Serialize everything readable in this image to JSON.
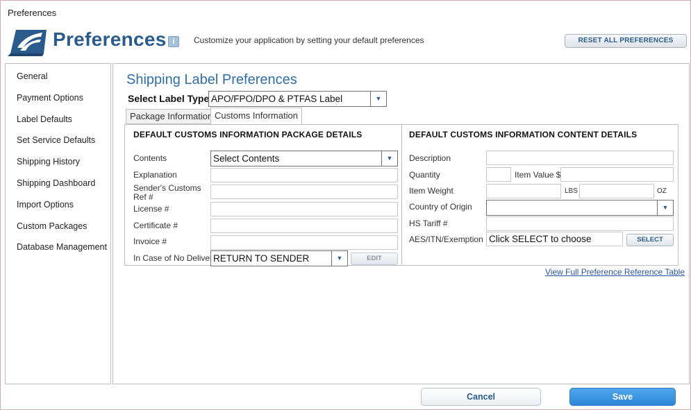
{
  "window": {
    "title": "Preferences"
  },
  "header": {
    "logo_icon": "usps-eagle-logo",
    "title": "Preferences",
    "info_icon": "info-icon",
    "info_glyph": "i",
    "subtitle": "Customize your application by setting your default preferences",
    "reset_label": "RESET ALL PREFERENCES",
    "brand_color": "#2b5b8c"
  },
  "sidebar": {
    "items": [
      {
        "label": "General"
      },
      {
        "label": "Payment Options"
      },
      {
        "label": "Label Defaults"
      },
      {
        "label": "Set Service Defaults"
      },
      {
        "label": "Shipping History"
      },
      {
        "label": "Shipping Dashboard"
      },
      {
        "label": "Import Options"
      },
      {
        "label": "Custom Packages"
      },
      {
        "label": "Database Management"
      }
    ]
  },
  "main": {
    "title": "Shipping Label Preferences",
    "label_type": {
      "label": "Select Label Type:",
      "value": "APO/FPO/DPO & PTFAS Label"
    },
    "tabs": [
      {
        "label": "Package Information",
        "active": false
      },
      {
        "label": "Customs Information",
        "active": true
      }
    ],
    "package_details": {
      "title": "DEFAULT CUSTOMS INFORMATION PACKAGE DETAILS",
      "contents_label": "Contents",
      "contents_value": "Select Contents",
      "explanation_label": "Explanation",
      "explanation_value": "",
      "senders_ref_label_line1": "Sender's Customs",
      "senders_ref_label_line2": "Ref #",
      "senders_ref_value": "",
      "license_label": "License #",
      "license_value": "",
      "certificate_label": "Certificate #",
      "certificate_value": "",
      "invoice_label": "Invoice #",
      "invoice_value": "",
      "no_delivery_label": "In Case of No Delivery",
      "no_delivery_value": "RETURN TO SENDER",
      "edit_label": "EDIT"
    },
    "content_details": {
      "title": "DEFAULT CUSTOMS INFORMATION CONTENT DETAILS",
      "description_label": "Description",
      "description_value": "",
      "quantity_label": "Quantity",
      "quantity_value": "",
      "item_value_label": "Item Value $",
      "item_value_value": "",
      "item_weight_label": "Item Weight",
      "weight_lbs_value": "",
      "lbs_label": "LBS",
      "weight_oz_value": "",
      "oz_label": "OZ",
      "country_label": "Country of Origin",
      "country_value": "",
      "hs_tariff_label": "HS Tariff #",
      "hs_tariff_value": "",
      "aes_label": "AES/ITN/Exemption",
      "aes_value": "Click SELECT to choose",
      "select_label": "SELECT"
    },
    "reference_link": "View Full Preference Reference Table"
  },
  "footer": {
    "cancel_label": "Cancel",
    "save_label": "Save",
    "save_color": "#2e86d6"
  }
}
